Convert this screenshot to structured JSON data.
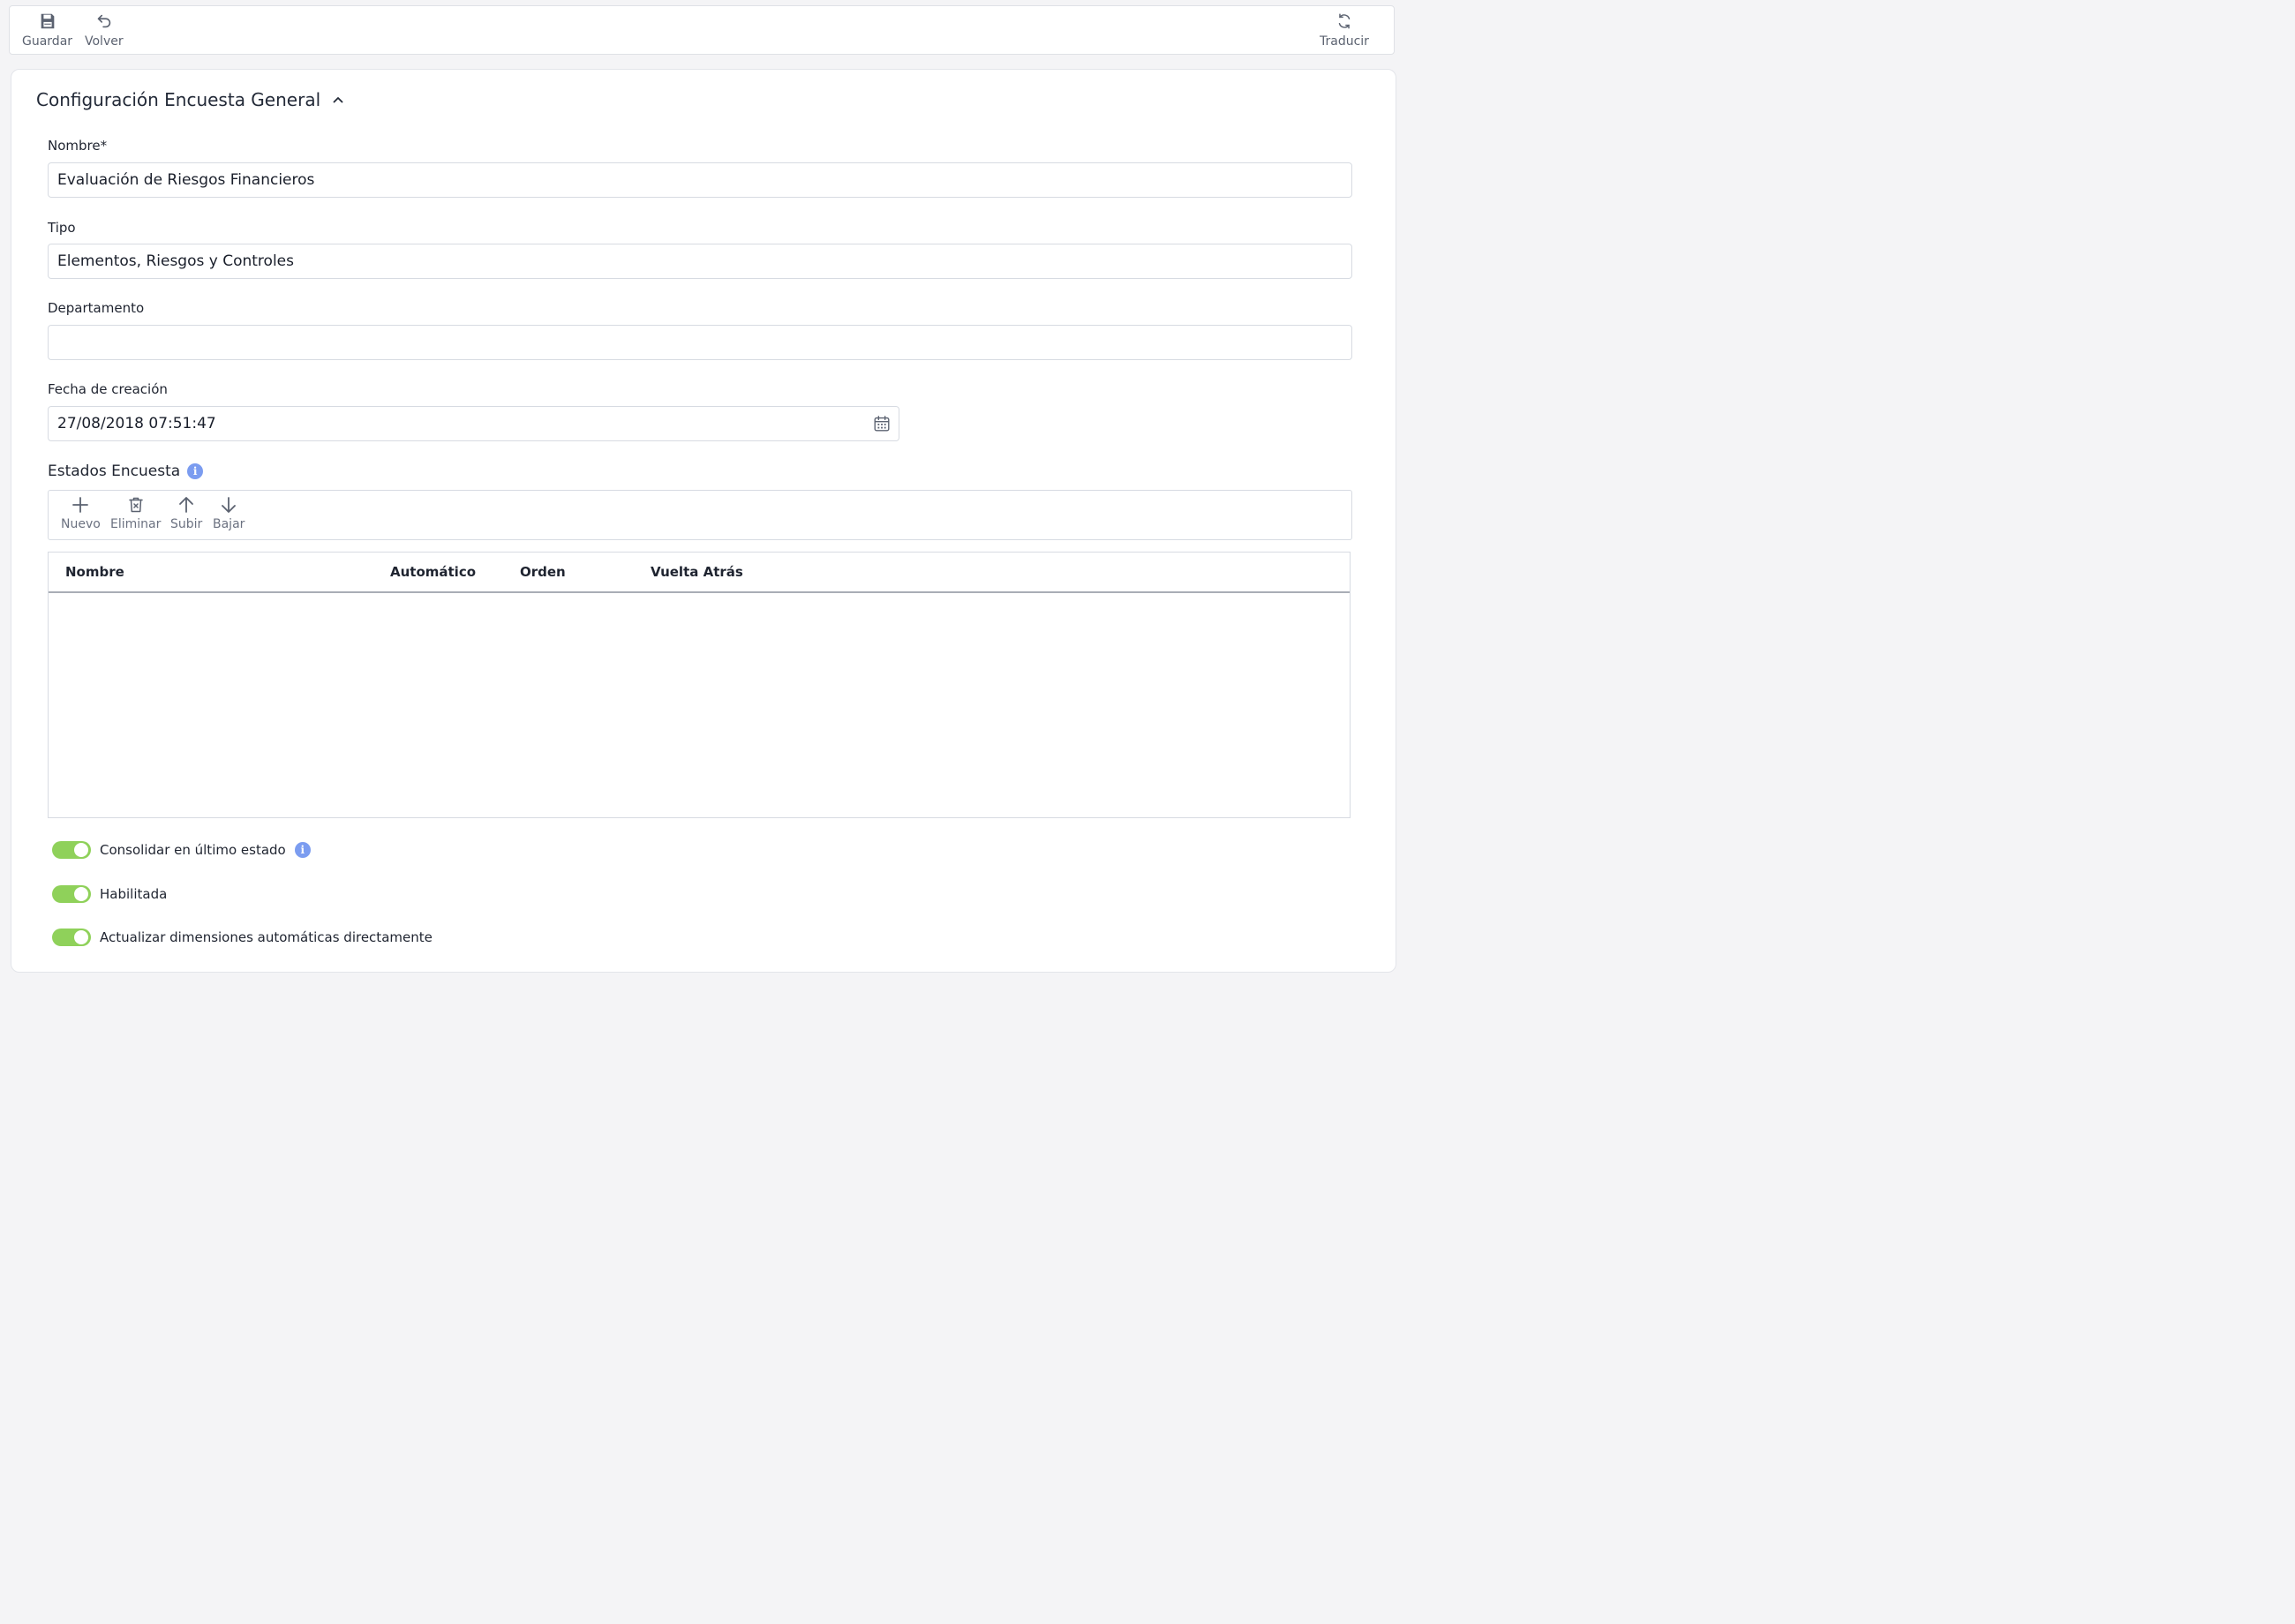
{
  "toolbar": {
    "save_label": "Guardar",
    "back_label": "Volver",
    "translate_label": "Traducir"
  },
  "section": {
    "title": "Configuración Encuesta General"
  },
  "form": {
    "nombre_label": "Nombre*",
    "nombre_value": "Evaluación de Riesgos Financieros",
    "tipo_label": "Tipo",
    "tipo_value": "Elementos, Riesgos y Controles",
    "departamento_label": "Departamento",
    "departamento_value": "",
    "fecha_label": "Fecha de creación",
    "fecha_value": "27/08/2018 07:51:47"
  },
  "estados": {
    "title": "Estados Encuesta",
    "buttons": {
      "nuevo": "Nuevo",
      "eliminar": "Eliminar",
      "subir": "Subir",
      "bajar": "Bajar"
    },
    "columns": [
      "Nombre",
      "Automático",
      "Orden",
      "Vuelta Atrás"
    ],
    "rows": []
  },
  "toggles": [
    {
      "label": "Consolidar en último estado",
      "on": true
    },
    {
      "label": "Habilitada",
      "on": true
    },
    {
      "label": "Actualizar dimensiones automáticas directamente",
      "on": true
    }
  ],
  "colors": {
    "toggle_on": "#8fd15a",
    "info": "#7b9cf0"
  }
}
